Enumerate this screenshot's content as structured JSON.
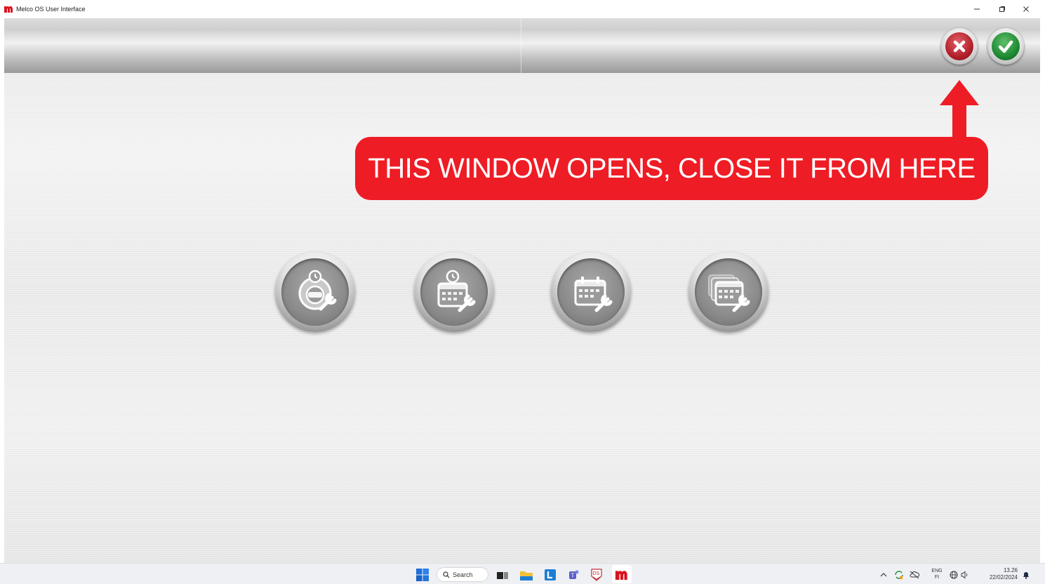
{
  "window": {
    "title": "Melco OS User Interface",
    "logo_letter": "m",
    "controls": {
      "minimize": "–",
      "restore": "▢",
      "close": "✕"
    }
  },
  "toolbar": {
    "cancel_icon": "x-icon",
    "ok_icon": "check-icon"
  },
  "annotation": {
    "text": "THIS WINDOW OPENS, CLOSE IT FROM HERE",
    "color": "#ee1c25"
  },
  "tools": [
    {
      "icon": "machine-maintenance-alarm-icon"
    },
    {
      "icon": "calendar-maintenance-alarm-icon"
    },
    {
      "icon": "calendar-maintenance-icon"
    },
    {
      "icon": "multi-calendar-maintenance-icon"
    }
  ],
  "taskbar": {
    "search_label": "Search",
    "ds_label": "DS",
    "melco_label": "m",
    "tray": {
      "lang_top": "ENG",
      "lang_bottom": "FI",
      "time": "13.26",
      "date": "22/02/2024"
    }
  },
  "colors": {
    "accent_red": "#ee1c25",
    "cancel_red": "#b3202b",
    "ok_green": "#1f8a33",
    "melco_red": "#d9141e"
  }
}
